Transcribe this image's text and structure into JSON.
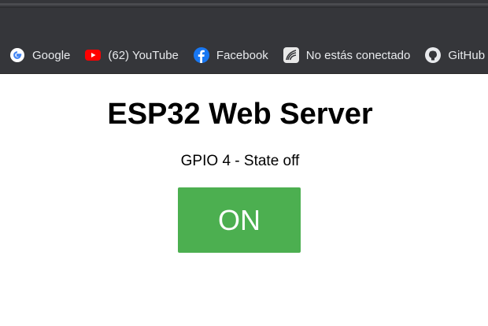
{
  "bookmarks": [
    {
      "label": "Google",
      "icon": "google-icon"
    },
    {
      "label": "(62) YouTube",
      "icon": "youtube-icon"
    },
    {
      "label": "Facebook",
      "icon": "facebook-icon"
    },
    {
      "label": "No estás conectado",
      "icon": "moodle-icon"
    },
    {
      "label": "GitHub",
      "icon": "github-icon"
    }
  ],
  "page": {
    "title": "ESP32 Web Server",
    "state_text": "GPIO 4 - State off",
    "button_label": "ON"
  },
  "colors": {
    "chrome_bg": "#35363a",
    "button_bg": "#4caf50",
    "youtube_red": "#ff0000",
    "facebook_blue": "#1877f2"
  }
}
